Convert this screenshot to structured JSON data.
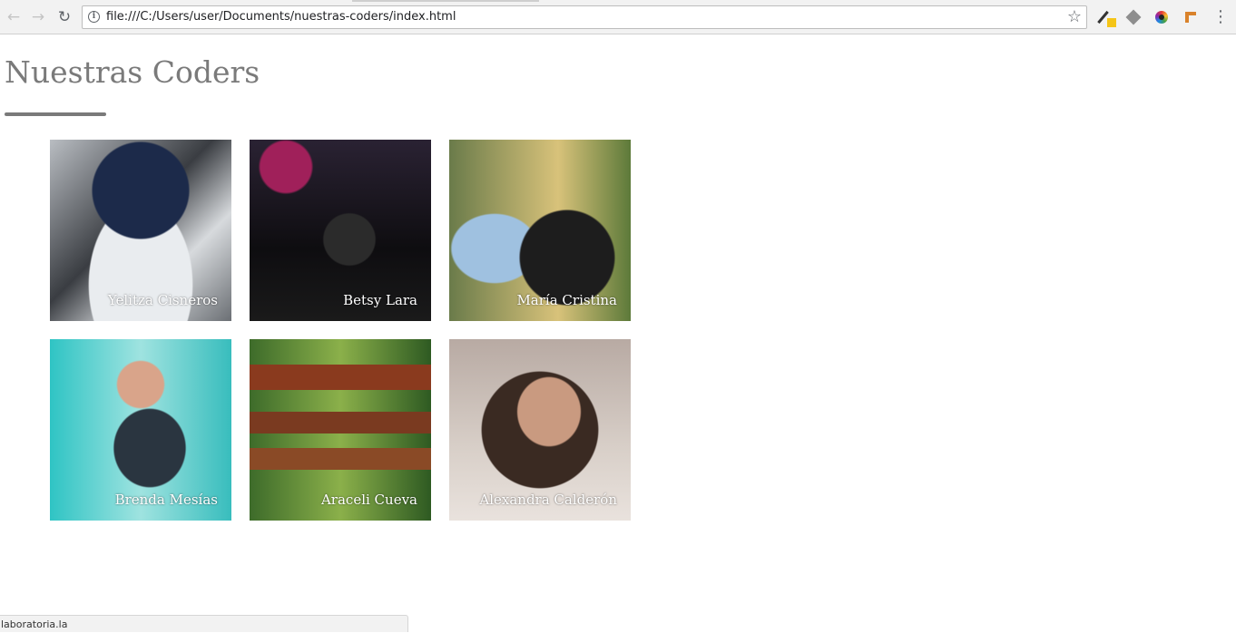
{
  "browser": {
    "url": "file:///C:/Users/user/Documents/nuestras-coders/index.html",
    "icons": {
      "back": "back-arrow-icon",
      "forward": "forward-arrow-icon",
      "reload": "reload-icon",
      "info": "info-icon",
      "bookmark": "star-icon",
      "menu": "more-vert-icon"
    },
    "status_url": "laboratoria.la"
  },
  "page": {
    "title": "Nuestras Coders",
    "title_color": "#7a7a7a",
    "coders": [
      {
        "name": "Yelitza Cisneros"
      },
      {
        "name": "Betsy Lara"
      },
      {
        "name": "María Cristina"
      },
      {
        "name": "Brenda Mesías"
      },
      {
        "name": "Araceli Cueva"
      },
      {
        "name": "Alexandra Calderón"
      }
    ]
  }
}
